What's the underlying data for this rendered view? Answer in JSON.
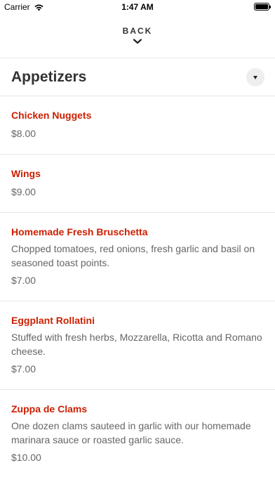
{
  "status_bar": {
    "carrier": "Carrier",
    "time": "1:47 AM"
  },
  "nav": {
    "back_label": "BACK"
  },
  "section": {
    "title": "Appetizers"
  },
  "items": [
    {
      "name": "Chicken Nuggets",
      "description": "",
      "price": "$8.00"
    },
    {
      "name": "Wings",
      "description": "",
      "price": "$9.00"
    },
    {
      "name": "Homemade Fresh Bruschetta",
      "description": "Chopped tomatoes, red onions, fresh garlic and basil on seasoned toast points.",
      "price": "$7.00"
    },
    {
      "name": "Eggplant Rollatini",
      "description": "Stuffed with fresh herbs, Mozzarella, Ricotta and Romano cheese.",
      "price": "$7.00"
    },
    {
      "name": "Zuppa de Clams",
      "description": "One dozen clams sauteed in garlic with our homemade marinara sauce or roasted garlic sauce.",
      "price": "$10.00"
    }
  ],
  "colors": {
    "accent": "#cc1f00",
    "muted_text": "#666666",
    "divider": "#e6e6e6"
  },
  "icons": {
    "wifi": "wifi-icon",
    "battery": "battery-icon",
    "back_chevron": "chevron-down-icon",
    "section_toggle": "caret-down-icon"
  }
}
